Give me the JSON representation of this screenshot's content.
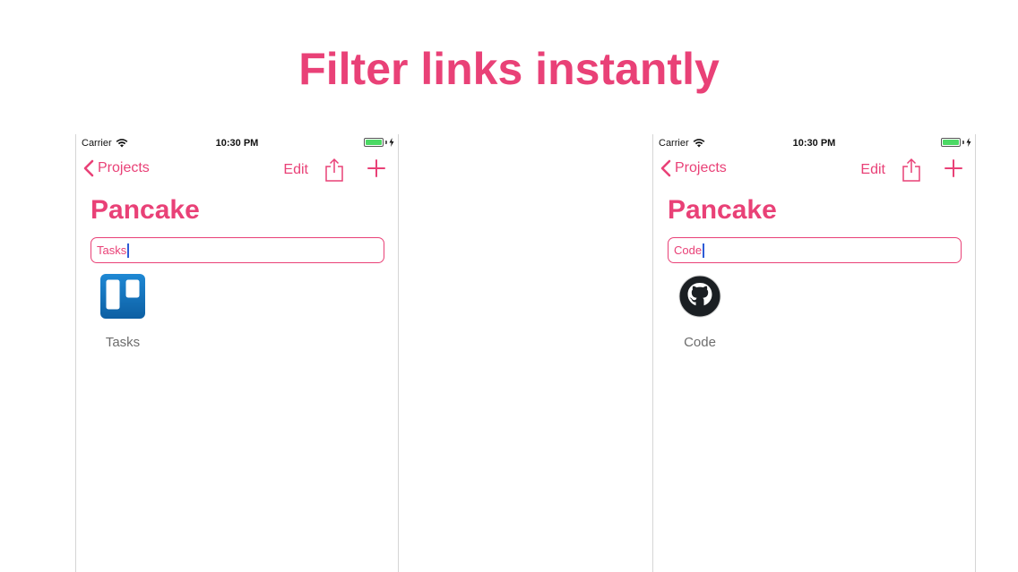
{
  "headline": "Filter links instantly",
  "colors": {
    "accent": "#e94177",
    "battery": "#4cd964",
    "caret": "#2d5bd6"
  },
  "screens": [
    {
      "status": {
        "carrier": "Carrier",
        "time": "10:30 PM"
      },
      "nav": {
        "back_label": "Projects",
        "edit_label": "Edit",
        "icons": [
          "chevron-left-icon",
          "share-icon",
          "plus-icon"
        ]
      },
      "title": "Pancake",
      "search": {
        "value": "Tasks"
      },
      "links": [
        {
          "label": "Tasks",
          "icon": "trello-icon"
        }
      ]
    },
    {
      "status": {
        "carrier": "Carrier",
        "time": "10:30 PM"
      },
      "nav": {
        "back_label": "Projects",
        "edit_label": "Edit",
        "icons": [
          "chevron-left-icon",
          "share-icon",
          "plus-icon"
        ]
      },
      "title": "Pancake",
      "search": {
        "value": "Code"
      },
      "links": [
        {
          "label": "Code",
          "icon": "github-icon"
        }
      ]
    }
  ]
}
